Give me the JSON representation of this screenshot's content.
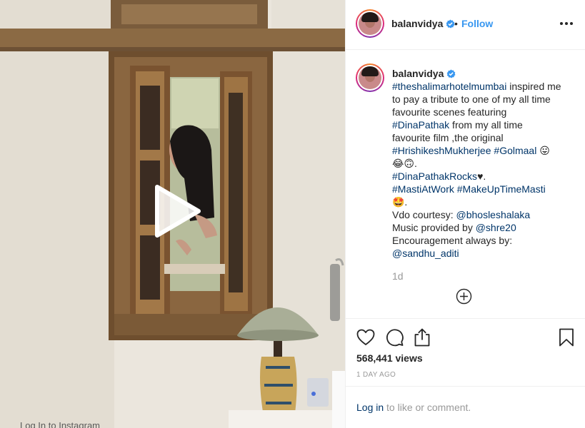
{
  "post": {
    "username": "balanvidya",
    "follow_separator": "•",
    "follow_label": "Follow",
    "caption": {
      "username": "balanvidya",
      "lines": [
        [
          {
            "t": "#theshalimarhotelmumbai",
            "link": true
          },
          {
            "t": " inspired me"
          }
        ],
        [
          {
            "t": "to pay a tribute to one of my all time"
          }
        ],
        [
          {
            "t": "favourite scenes featuring"
          }
        ],
        [
          {
            "t": "#DinaPathak",
            "link": true
          },
          {
            "t": " from my all time"
          }
        ],
        [
          {
            "t": "favourite film ,the original"
          }
        ],
        [
          {
            "t": "#HrishikeshMukherjee",
            "link": true
          },
          {
            "t": " "
          },
          {
            "t": "#Golmaal",
            "link": true
          },
          {
            "t": " 😛"
          }
        ],
        [
          {
            "t": "😂🙃."
          }
        ],
        [
          {
            "t": "#DinaPathakRocks",
            "link": true
          },
          {
            "t": "♥."
          }
        ],
        [
          {
            "t": "#MastiAtWork",
            "link": true
          },
          {
            "t": " "
          },
          {
            "t": "#MakeUpTimeMasti",
            "link": true
          }
        ],
        [
          {
            "t": "🤩."
          }
        ],
        [
          {
            "t": "Vdo courtesy: "
          },
          {
            "t": "@bhosleshalaka",
            "link": true
          }
        ],
        [
          {
            "t": "Music provided by "
          },
          {
            "t": "@shre20",
            "link": true
          }
        ],
        [
          {
            "t": "Encouragement always by:"
          }
        ],
        [
          {
            "t": "@sandhu_aditi",
            "link": true
          }
        ]
      ],
      "age": "1d"
    },
    "views": "568,441 views",
    "date": "1 DAY AGO",
    "login_link": "Log in",
    "login_rest": " to like or comment."
  },
  "media": {
    "bottom_caption": "Log In to Instagram"
  },
  "icons": {
    "verified": "verified-badge-icon",
    "more": "more-options-icon",
    "add": "plus-circle-icon",
    "like": "heart-icon",
    "comment": "comment-icon",
    "share": "share-icon",
    "save": "bookmark-icon",
    "play": "play-icon"
  },
  "colors": {
    "link": "#003569",
    "follow": "#3897f0",
    "verified": "#3897f0",
    "muted": "#999999"
  }
}
